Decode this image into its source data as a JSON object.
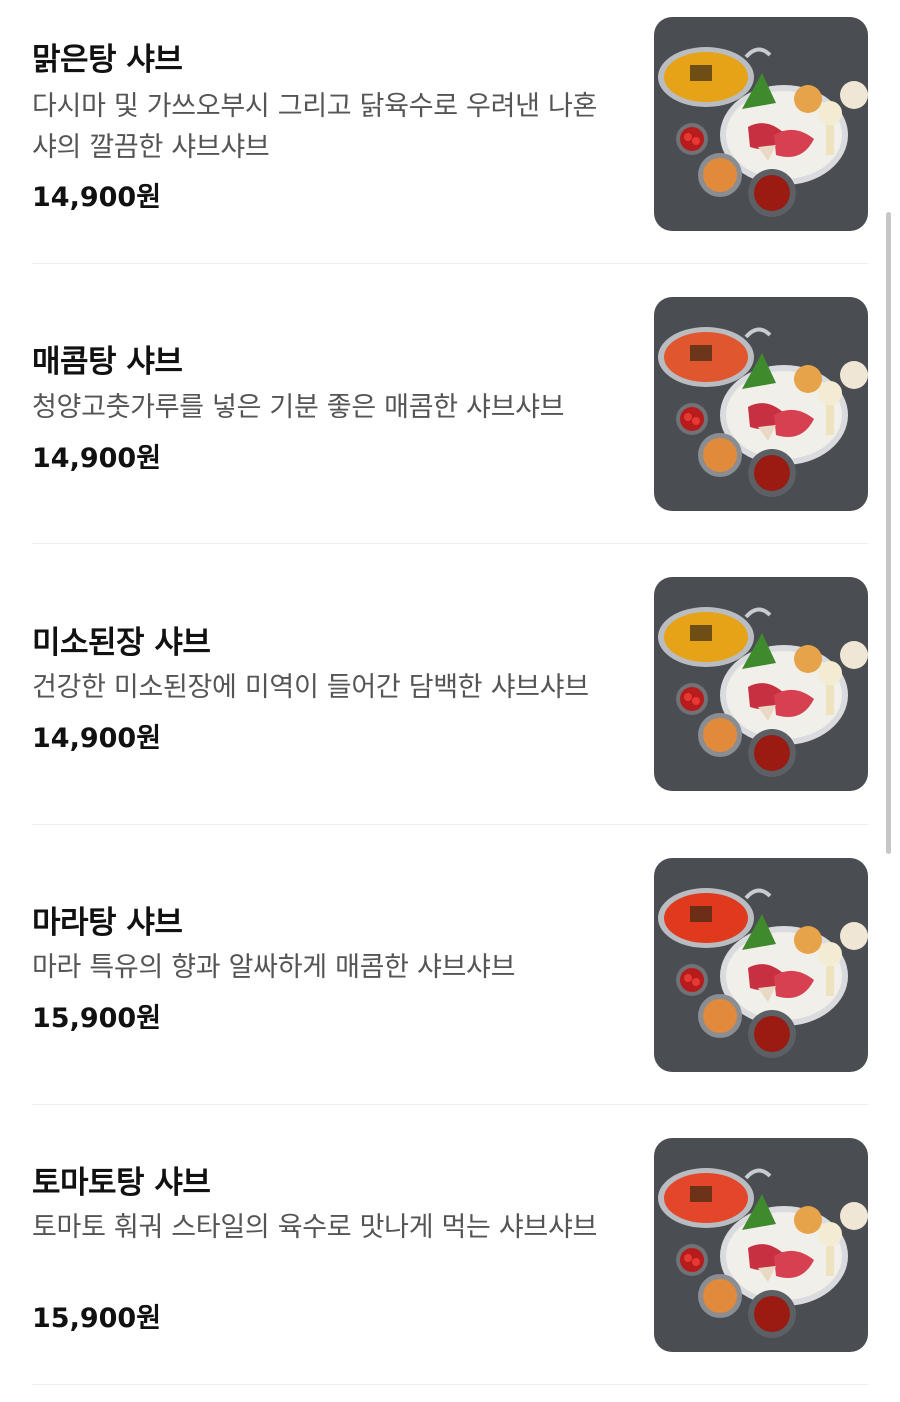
{
  "menu": {
    "items": [
      {
        "name": "맑은탕 샤브",
        "description": "다시마 및 가쓰오부시 그리고 닭육수로 우려낸 나혼샤의 깔끔한 샤브샤브",
        "price": "14,900원",
        "broth_color": "#e6a317",
        "image": "clear-broth-shabu-photo"
      },
      {
        "name": "매콤탕 샤브",
        "description": "청양고춧가루를 넣은 기분 좋은 매콤한 샤브샤브",
        "price": "14,900원",
        "broth_color": "#e0562e",
        "image": "spicy-broth-shabu-photo"
      },
      {
        "name": "미소된장 샤브",
        "description": "건강한 미소된장에 미역이 들어간 담백한 샤브샤브",
        "price": "14,900원",
        "broth_color": "#e6a317",
        "image": "miso-broth-shabu-photo"
      },
      {
        "name": "마라탕 샤브",
        "description": "마라 특유의 향과 알싸하게 매콤한 샤브샤브",
        "price": "15,900원",
        "broth_color": "#e03a1e",
        "image": "mala-broth-shabu-photo"
      },
      {
        "name": "토마토탕 샤브",
        "description": "토마토 훠궈 스타일의 육수로 맛나게 먹는 샤브샤브",
        "price": "15,900원",
        "broth_color": "#e4462a",
        "image": "tomato-broth-shabu-photo"
      }
    ]
  },
  "colors": {
    "background": "#ffffff",
    "title_text": "#111111",
    "description_text": "#555555",
    "divider": "#eeeeee",
    "photo_table": "#4a4d52"
  }
}
